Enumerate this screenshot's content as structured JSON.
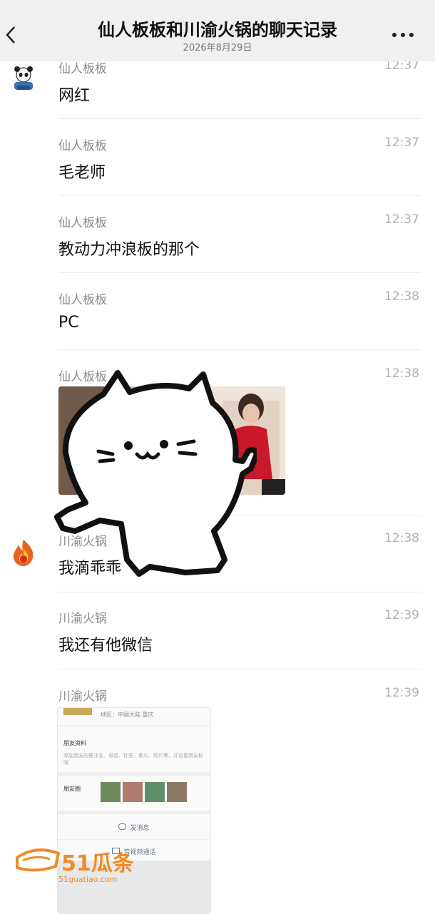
{
  "header": {
    "title": "仙人板板和川渝火锅的聊天记录",
    "date": "2026年8月29日"
  },
  "messages": [
    {
      "sender": "仙人板板",
      "time": "12:37",
      "text": "网红"
    },
    {
      "sender": "仙人板板",
      "time": "12:37",
      "text": "毛老师"
    },
    {
      "sender": "仙人板板",
      "time": "12:37",
      "text": "教动力冲浪板的那个"
    },
    {
      "sender": "仙人板板",
      "time": "12:38",
      "text": "PC"
    },
    {
      "sender": "仙人板板",
      "time": "12:38",
      "text": ""
    },
    {
      "sender": "川渝火锅",
      "time": "12:38",
      "text": "我滴乖乖"
    },
    {
      "sender": "川渝火锅",
      "time": "12:39",
      "text": "我还有他微信"
    },
    {
      "sender": "川渝火锅",
      "time": "12:39",
      "text": ""
    }
  ],
  "profile_card": {
    "region": "地区：中国大陆  重庆",
    "section_info": "朋友资料",
    "info_desc": "添加朋友的备注名、电话、标签、备忘、照片等，并设置朋友权限",
    "section_moments": "朋友圈",
    "send_message": "发消息",
    "video_call": "音视频通话"
  },
  "watermark": {
    "brand": "51瓜条",
    "url": "51guatiao.com"
  },
  "colors": {
    "header_bg": "#f0f0f0",
    "divider": "#ececec",
    "watermark": "#f08a24"
  },
  "icons": [
    "back-arrow-icon",
    "more-dots-icon",
    "panda-avatar-icon",
    "flame-avatar-icon",
    "message-icon",
    "video-call-icon"
  ]
}
